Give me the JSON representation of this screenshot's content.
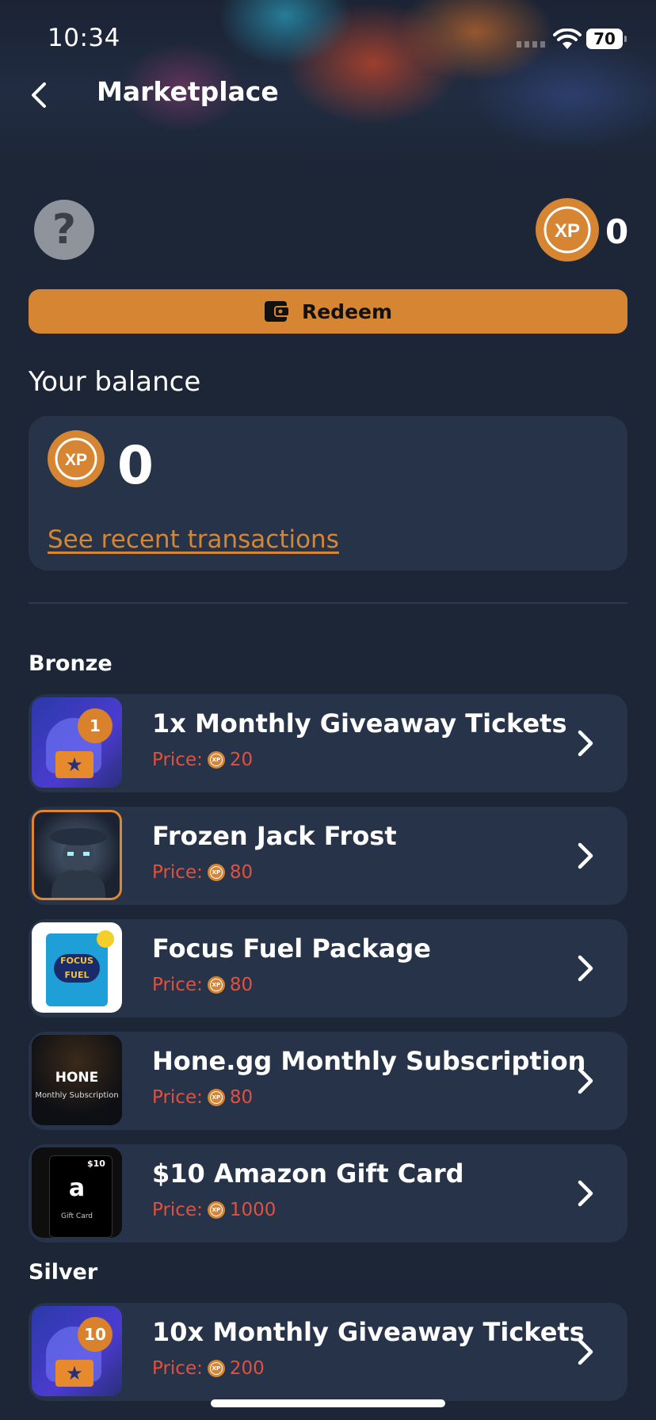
{
  "status_bar": {
    "time": "10:34",
    "battery": "70"
  },
  "header": {
    "title": "Marketplace"
  },
  "top": {
    "help_symbol": "?",
    "xp_badge": "XP",
    "xp_value": "0"
  },
  "redeem": {
    "label": "Redeem",
    "icon": "wallet-icon"
  },
  "balance": {
    "title": "Your balance",
    "xp_badge": "XP",
    "value": "0",
    "transactions_link": "See recent transactions"
  },
  "colors": {
    "accent": "#d68533",
    "price": "#e0513f",
    "background": "#1c2636",
    "card": "#263349"
  },
  "sections": [
    {
      "label": "Bronze",
      "items": [
        {
          "title": "1x Monthly Giveaway Tickets",
          "price_label": "Price:",
          "price": "20",
          "badge": "1"
        },
        {
          "title": "Frozen Jack Frost",
          "price_label": "Price:",
          "price": "80"
        },
        {
          "title": "Focus Fuel Package",
          "price_label": "Price:",
          "price": "80",
          "thumb_text": "FOCUS FUEL"
        },
        {
          "title": "Hone.gg Monthly Subscription",
          "price_label": "Price:",
          "price": "80",
          "thumb_brand": "HONE",
          "thumb_sub": "Monthly Subscription"
        },
        {
          "title": "$10 Amazon Gift Card",
          "price_label": "Price:",
          "price": "1000",
          "thumb_amount": "$10",
          "thumb_logo": "a",
          "thumb_caption": "Gift Card"
        }
      ]
    },
    {
      "label": "Silver",
      "items": [
        {
          "title": "10x Monthly Giveaway Tickets",
          "price_label": "Price:",
          "price": "200",
          "badge": "10"
        }
      ]
    }
  ],
  "mini_xp": "XP"
}
